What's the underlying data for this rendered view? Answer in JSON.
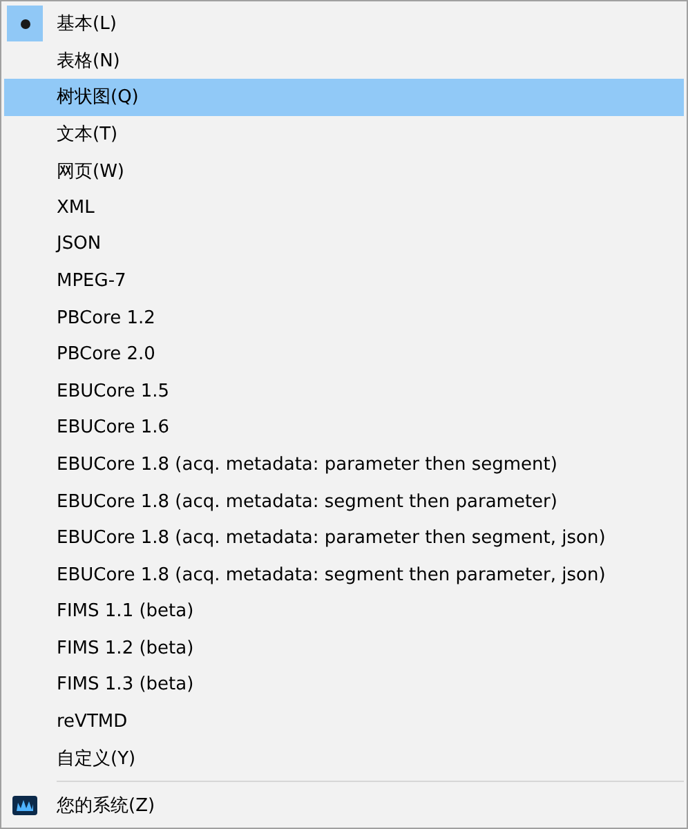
{
  "menu": {
    "items": [
      {
        "kind": "option",
        "label": "基本(L)",
        "checked": true,
        "selected": false
      },
      {
        "kind": "option",
        "label": "表格(N)",
        "checked": false,
        "selected": false
      },
      {
        "kind": "option",
        "label": "树状图(Q)",
        "checked": false,
        "selected": true
      },
      {
        "kind": "option",
        "label": "文本(T)",
        "checked": false,
        "selected": false
      },
      {
        "kind": "option",
        "label": "网页(W)",
        "checked": false,
        "selected": false
      },
      {
        "kind": "option",
        "label": "XML",
        "checked": false,
        "selected": false
      },
      {
        "kind": "option",
        "label": "JSON",
        "checked": false,
        "selected": false
      },
      {
        "kind": "option",
        "label": "MPEG-7",
        "checked": false,
        "selected": false
      },
      {
        "kind": "option",
        "label": "PBCore 1.2",
        "checked": false,
        "selected": false
      },
      {
        "kind": "option",
        "label": "PBCore 2.0",
        "checked": false,
        "selected": false
      },
      {
        "kind": "option",
        "label": "EBUCore 1.5",
        "checked": false,
        "selected": false
      },
      {
        "kind": "option",
        "label": "EBUCore 1.6",
        "checked": false,
        "selected": false
      },
      {
        "kind": "option",
        "label": "EBUCore 1.8 (acq. metadata: parameter then segment)",
        "checked": false,
        "selected": false
      },
      {
        "kind": "option",
        "label": "EBUCore 1.8 (acq. metadata: segment then parameter)",
        "checked": false,
        "selected": false
      },
      {
        "kind": "option",
        "label": "EBUCore 1.8 (acq. metadata: parameter then segment, json)",
        "checked": false,
        "selected": false
      },
      {
        "kind": "option",
        "label": "EBUCore 1.8 (acq. metadata: segment then parameter, json)",
        "checked": false,
        "selected": false
      },
      {
        "kind": "option",
        "label": "FIMS 1.1 (beta)",
        "checked": false,
        "selected": false
      },
      {
        "kind": "option",
        "label": "FIMS 1.2 (beta)",
        "checked": false,
        "selected": false
      },
      {
        "kind": "option",
        "label": "FIMS 1.3 (beta)",
        "checked": false,
        "selected": false
      },
      {
        "kind": "option",
        "label": "reVTMD",
        "checked": false,
        "selected": false
      },
      {
        "kind": "option",
        "label": "自定义(Y)",
        "checked": false,
        "selected": false
      },
      {
        "kind": "separator"
      },
      {
        "kind": "app",
        "label": "您的系统(Z)",
        "selected": false
      }
    ]
  }
}
